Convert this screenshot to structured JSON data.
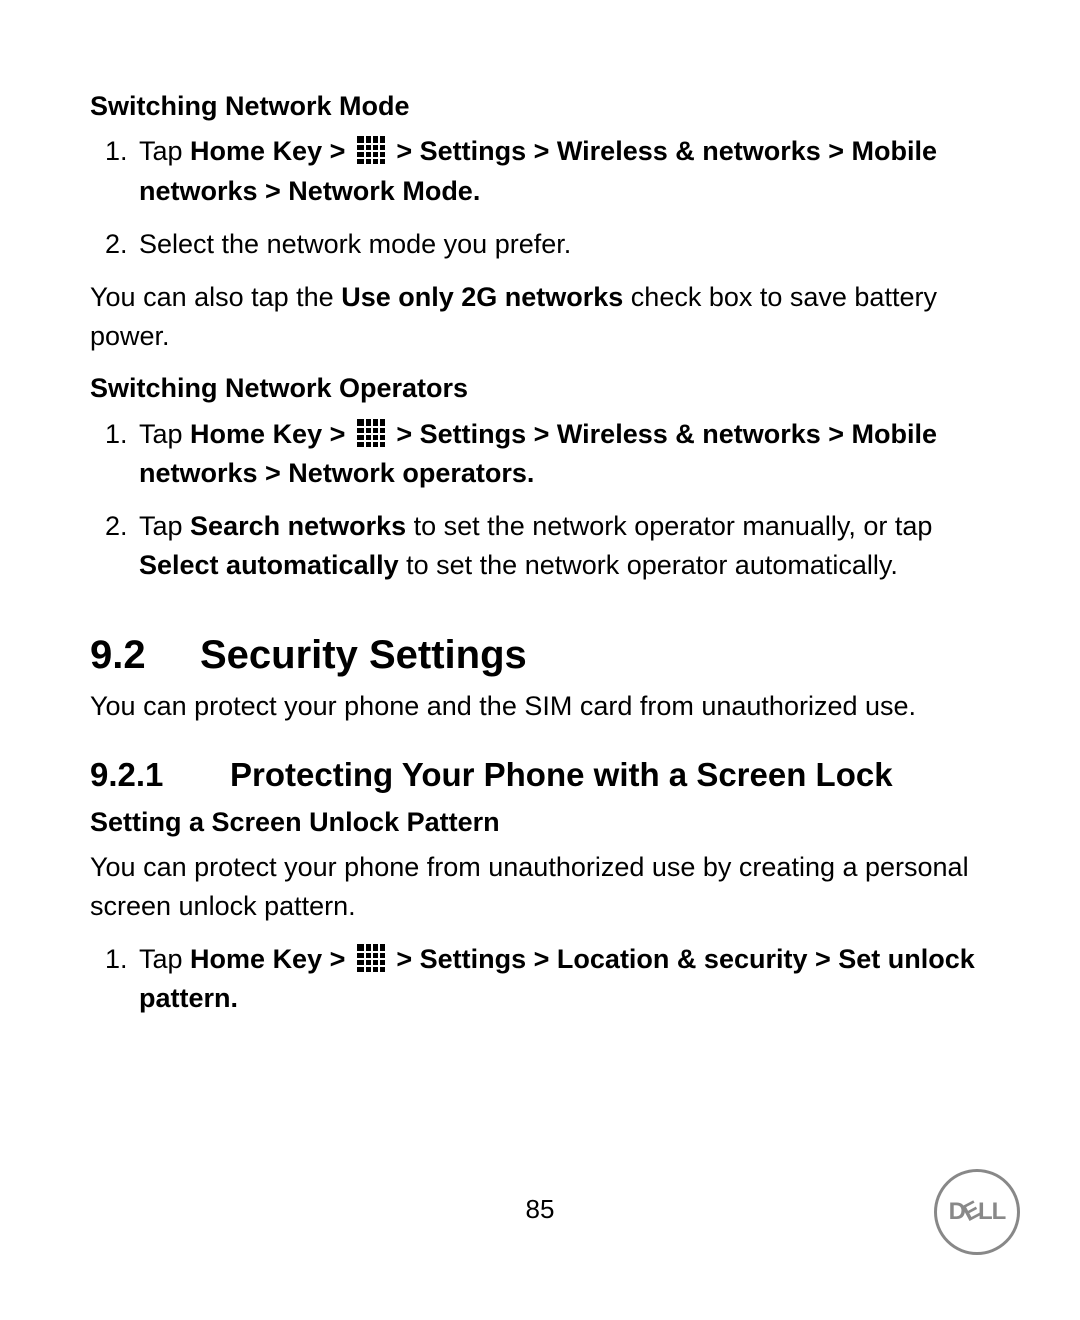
{
  "headers": {
    "h1": "Switching Network Mode",
    "h2": "Switching Network Operators",
    "h3": "Setting a Screen Unlock Pattern"
  },
  "section": {
    "num": "9.2",
    "title": "Security Settings",
    "intro": "You can protect your phone and the SIM card from unauthorized use."
  },
  "subsection": {
    "num": "9.2.1",
    "title": "Protecting Your Phone with a Screen Lock",
    "intro": "You can protect your phone from unauthorized use by creating a personal screen unlock pattern."
  },
  "steps_mode": {
    "s1_a": "Tap ",
    "s1_b": "Home Key > ",
    "s1_c": "  > Settings > Wireless & networks > Mobile networks > Network Mode.",
    "s2": "Select the network mode you prefer."
  },
  "steps_mode_note_a": "You can also tap the ",
  "steps_mode_note_b": "Use only 2G networks",
  "steps_mode_note_c": " check box to save battery power.",
  "steps_op": {
    "s1_a": "Tap ",
    "s1_b": "Home Key > ",
    "s1_c": "  > Settings > Wireless & networks > Mobile networks > Network operators.",
    "s2_a": "Tap ",
    "s2_b": "Search networks",
    "s2_c": " to set the network operator manually, or tap ",
    "s2_d": "Select automatically",
    "s2_e": " to set the network operator automatically."
  },
  "steps_lock": {
    "s1_a": "Tap ",
    "s1_b": "Home Key > ",
    "s1_c": "  > Settings > Location & security > Set unlock pattern."
  },
  "page_number": "85",
  "logo": {
    "d": "D",
    "e": "E",
    "l1": "L",
    "l2": "L"
  }
}
